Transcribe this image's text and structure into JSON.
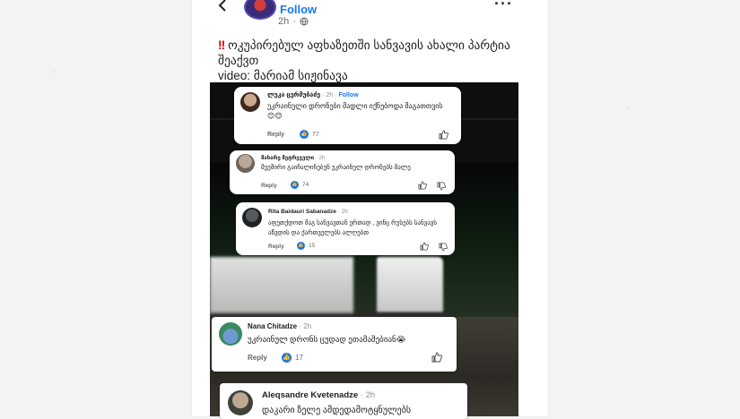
{
  "post": {
    "follow_label": "Follow",
    "time": "2h",
    "text": "ოკუპირებულ აფხაზეთში სანვავის ახალი პარტია შეაქვთ",
    "video_credit": "video: მარიამ სიჟინავა"
  },
  "comments": [
    {
      "name": "ლუკა ცერმუბაძე",
      "time": "2h",
      "follow_label": "Follow",
      "text": "უკრაინული დრონები მადლი იქნებოდა მაგათთვის😊😊",
      "reply_label": "Reply",
      "likes": "77"
    },
    {
      "name": "მახარე მეტრეველი",
      "time": "2h",
      "text": "შეემირი გაიჩალიჩებენ უკრაინულ დრონებს მალე",
      "reply_label": "Reply",
      "likes": "74"
    },
    {
      "name": "Rita Baidauri Sabanadze",
      "time": "2h",
      "text": "აფეთქდოთ მაგ სანვავთან ერთად , ვინც რუსებს სანვავს აწვდის და ქართველებს ალღებთ",
      "reply_label": "Reply",
      "likes": "15"
    },
    {
      "name": "Nana Chitadze",
      "time": "2h",
      "text": "უკრაინულ დრონს ცუდად ეთამაშებიან😭",
      "reply_label": "Reply",
      "likes": "17"
    },
    {
      "name": "Aleqsandre Kvetenadze",
      "time": "2h",
      "text": "დაკარი ზელე ამდედამოტყნულებს"
    }
  ],
  "icons": {
    "back": "arrow-left-icon",
    "more": "more-dots-icon",
    "globe": "globe-icon",
    "like": "thumbs-up-icon",
    "dislike": "thumbs-down-icon",
    "warning": "double-exclamation-icon"
  },
  "colors": {
    "accent": "#1877f2",
    "warning": "#d40000"
  }
}
